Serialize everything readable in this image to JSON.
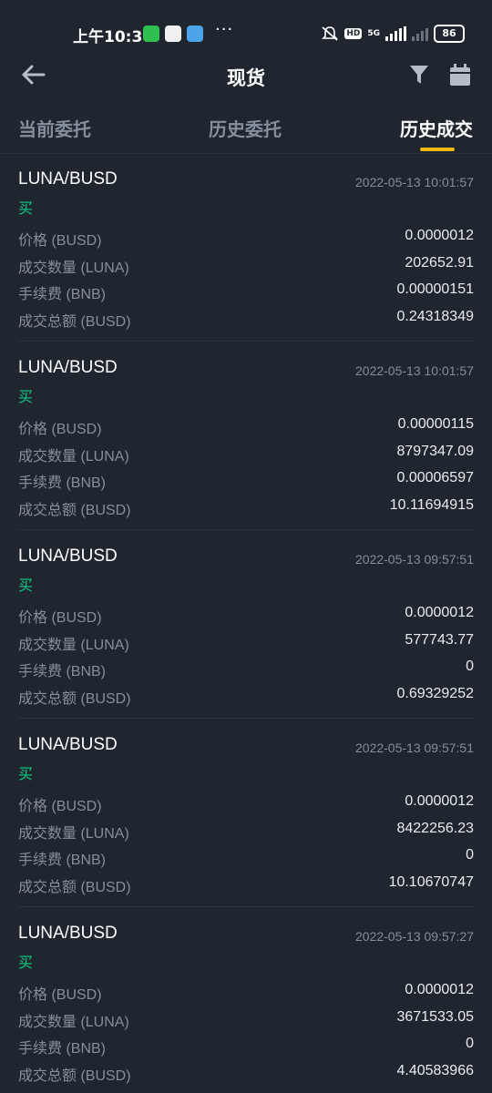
{
  "status_bar": {
    "time": "上午10:30",
    "network": "5G",
    "hd": "HD",
    "battery": "86",
    "dots": "···"
  },
  "header": {
    "title": "现货"
  },
  "tabs": [
    {
      "label": "当前委托",
      "active": false
    },
    {
      "label": "历史委托",
      "active": false
    },
    {
      "label": "历史成交",
      "active": true
    }
  ],
  "colors": {
    "accent": "#f0b90b",
    "buy": "#0ecb81",
    "background": "#1f2630"
  },
  "field_labels": {
    "price": "价格 (BUSD)",
    "quantity": "成交数量 (LUNA)",
    "fee": "手续费 (BNB)",
    "total": "成交总额 (BUSD)"
  },
  "trades": [
    {
      "pair": "LUNA/BUSD",
      "time": "2022-05-13 10:01:57",
      "side": "买",
      "price": "0.0000012",
      "quantity": "202652.91",
      "fee": "0.00000151",
      "total": "0.24318349"
    },
    {
      "pair": "LUNA/BUSD",
      "time": "2022-05-13 10:01:57",
      "side": "买",
      "price": "0.00000115",
      "quantity": "8797347.09",
      "fee": "0.00006597",
      "total": "10.11694915"
    },
    {
      "pair": "LUNA/BUSD",
      "time": "2022-05-13 09:57:51",
      "side": "买",
      "price": "0.0000012",
      "quantity": "577743.77",
      "fee": "0",
      "total": "0.69329252"
    },
    {
      "pair": "LUNA/BUSD",
      "time": "2022-05-13 09:57:51",
      "side": "买",
      "price": "0.0000012",
      "quantity": "8422256.23",
      "fee": "0",
      "total": "10.10670747"
    },
    {
      "pair": "LUNA/BUSD",
      "time": "2022-05-13 09:57:27",
      "side": "买",
      "price": "0.0000012",
      "quantity": "3671533.05",
      "fee": "0",
      "total": "4.40583966"
    }
  ]
}
